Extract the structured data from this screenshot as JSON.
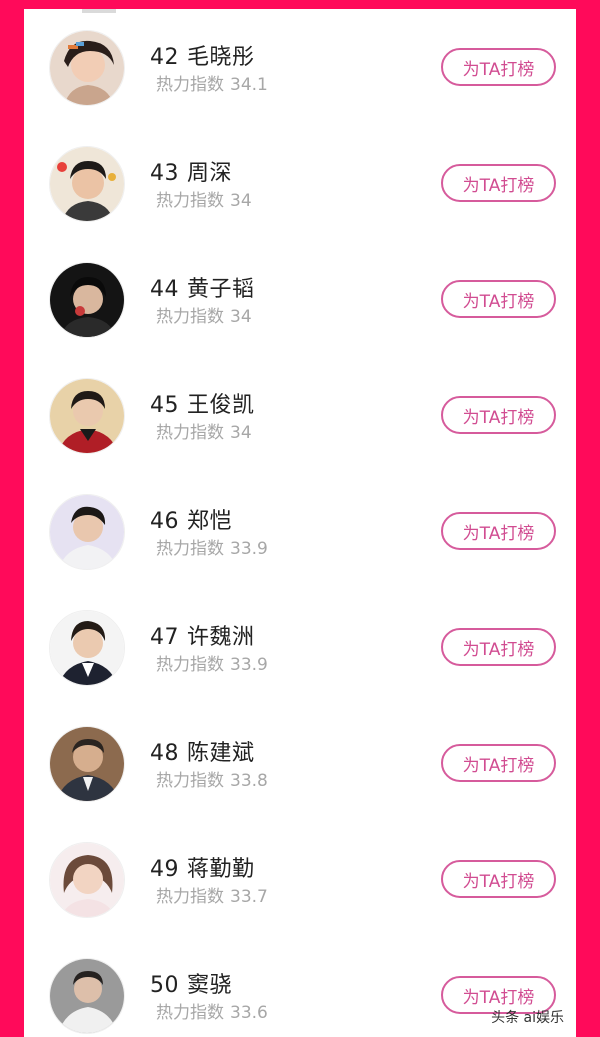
{
  "heat_label": "热力指数",
  "vote_label": "为TA打榜",
  "watermark": "头条 ai娱乐",
  "accent_color": "#FF0A5A",
  "button_color": "#D14C91",
  "items": [
    {
      "rank": "42",
      "name": "毛晓彤",
      "score": "34.1"
    },
    {
      "rank": "43",
      "name": "周深",
      "score": "34"
    },
    {
      "rank": "44",
      "name": "黄子韬",
      "score": "34"
    },
    {
      "rank": "45",
      "name": "王俊凯",
      "score": "34"
    },
    {
      "rank": "46",
      "name": "郑恺",
      "score": "33.9"
    },
    {
      "rank": "47",
      "name": "许魏洲",
      "score": "33.9"
    },
    {
      "rank": "48",
      "name": "陈建斌",
      "score": "33.8"
    },
    {
      "rank": "49",
      "name": "蒋勤勤",
      "score": "33.7"
    },
    {
      "rank": "50",
      "name": "窦骁",
      "score": "33.6"
    }
  ]
}
